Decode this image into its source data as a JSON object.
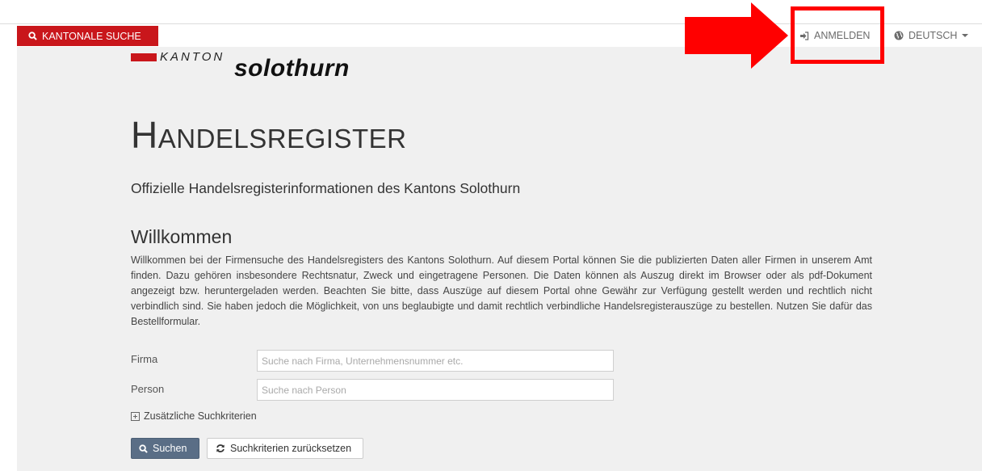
{
  "header": {
    "kantonale_suche": "KANTONALE SUCHE",
    "login": "ANMELDEN",
    "language": "DEUTSCH"
  },
  "logo": {
    "kanton": "KANTON",
    "name": "solothurn"
  },
  "page": {
    "title_first": "H",
    "title_rest": "ANDELSREGISTER",
    "subtitle": "Offizielle Handelsregisterinformationen des Kantons Solothurn",
    "welcome_heading": "Willkommen",
    "intro": "Willkommen bei der Firmensuche des Handelsregisters des Kantons Solothurn. Auf diesem Portal können Sie die publizierten Daten aller Firmen in unserem Amt finden. Dazu gehören insbesondere Rechtsnatur, Zweck und eingetragene Personen. Die Daten können als Auszug direkt im Browser oder als pdf-Dokument angezeigt bzw. heruntergeladen werden. Beachten Sie bitte, dass Auszüge auf diesem Portal ohne Gewähr zur Verfügung gestellt werden und rechtlich nicht verbindlich sind. Sie haben jedoch die Möglichkeit, von uns beglaubigte und damit rechtlich verbindliche Handelsregisterauszüge zu bestellen. Nutzen Sie dafür das Bestellformular."
  },
  "form": {
    "firma_label": "Firma",
    "firma_value": "",
    "firma_placeholder": "Suche nach Firma, Unternehmensnummer etc.",
    "person_label": "Person",
    "person_value": "",
    "person_placeholder": "Suche nach Person",
    "extra_criteria": "Zusätzliche Suchkriterien",
    "search_button": "Suchen",
    "reset_button": "Suchkriterien zurücksetzen"
  },
  "colors": {
    "brand_red": "#c9161b",
    "annotation_red": "#ff0000",
    "search_button": "#5a6e86",
    "panel_background": "#f0f0f0"
  },
  "icons": {
    "kantonale_suche": "search-icon",
    "login": "sign-in-icon",
    "language": "globe-icon",
    "search": "search-icon",
    "reset": "refresh-icon",
    "extra_criteria": "plus-square-icon"
  }
}
